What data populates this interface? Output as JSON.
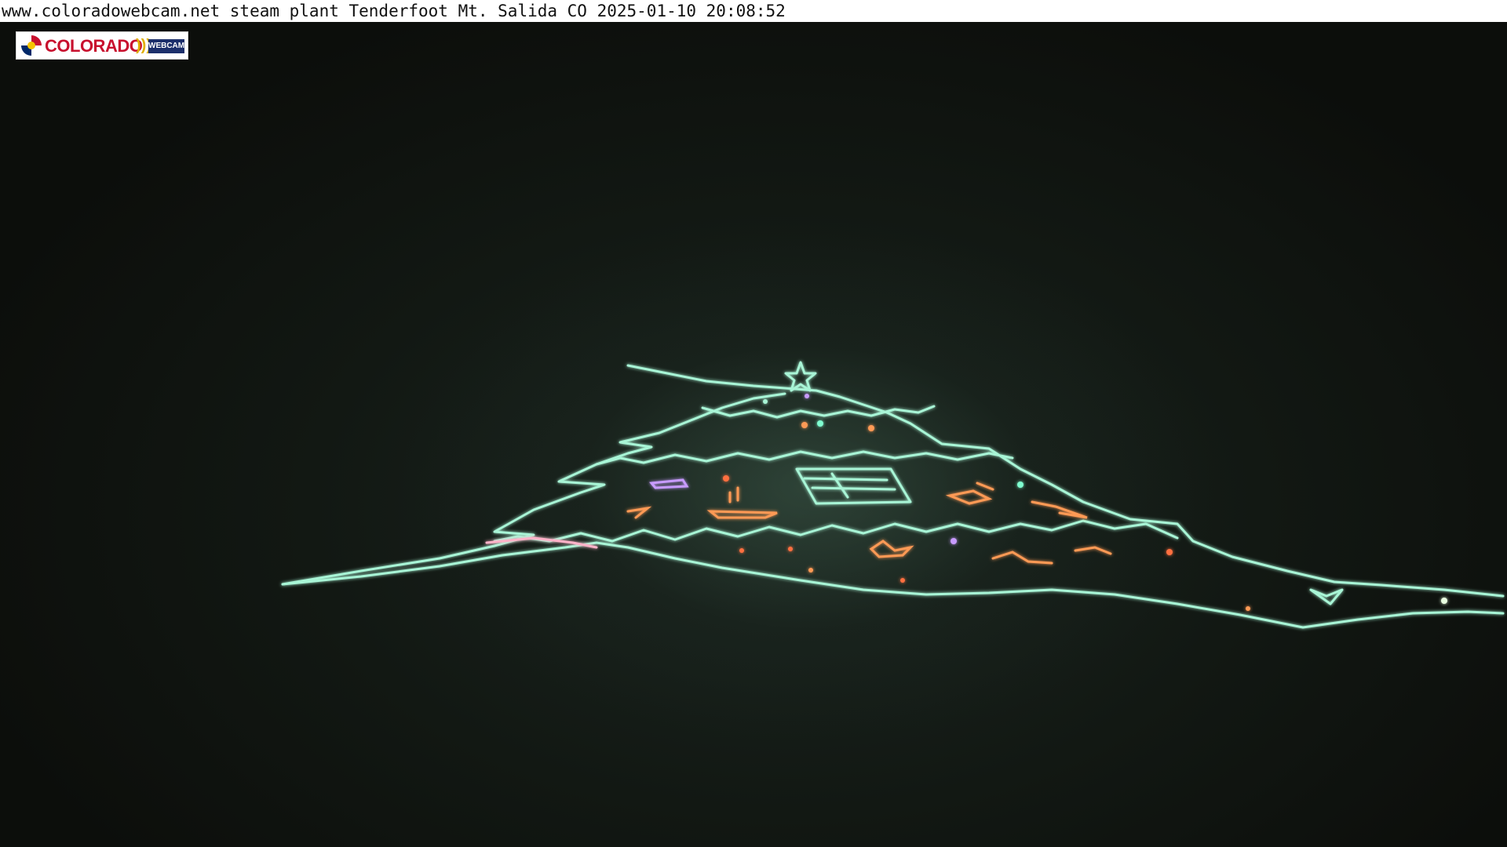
{
  "caption": {
    "text": "www.coloradowebcam.net steam plant Tenderfoot Mt. Salida CO 2025-01-10 20:08:52"
  },
  "logo": {
    "wordmark": "COLORADO",
    "badge": "WEBCAM"
  },
  "colors": {
    "caption_background": "#ffffff",
    "night_sky": "#0d0f0c",
    "light_outline": "#a8f5d6",
    "light_warm": "#ff9a55",
    "light_purple": "#c89bff",
    "logo_red": "#c8102e",
    "logo_blue": "#1c2f6b"
  }
}
